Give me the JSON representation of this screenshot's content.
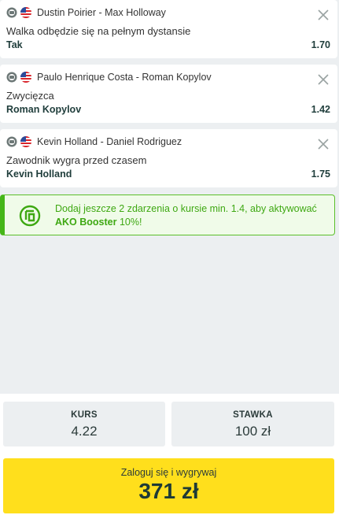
{
  "bets": [
    {
      "match": "Dustin Poirier - Max Holloway",
      "market": "Walka odbędzie się na pełnym dystansie",
      "pick": "Tak",
      "odd": "1.70"
    },
    {
      "match": "Paulo Henrique Costa - Roman Kopylov",
      "market": "Zwycięzca",
      "pick": "Roman Kopylov",
      "odd": "1.42"
    },
    {
      "match": "Kevin Holland - Daniel Rodriguez",
      "market": "Zawodnik wygra przed czasem",
      "pick": "Kevin Holland",
      "odd": "1.75"
    }
  ],
  "booster": {
    "text_before": "Dodaj jeszcze 2 zdarzenia o kursie min. 1.4, aby aktywować ",
    "highlight": "AKO Booster",
    "text_after": " 10%!",
    "accent_color": "#45b618"
  },
  "summary": {
    "odds_label": "KURS",
    "odds_value": "4.22",
    "stake_label": "STAWKA",
    "stake_value": "100 zł"
  },
  "cta": {
    "title": "Zaloguj się i wygrywaj",
    "amount": "371 zł",
    "color": "#ffdf1c"
  },
  "icons": {
    "sport": "mma-sport-icon",
    "country": "usa-flag-icon",
    "remove": "close-icon",
    "booster": "ako-booster-icon"
  }
}
